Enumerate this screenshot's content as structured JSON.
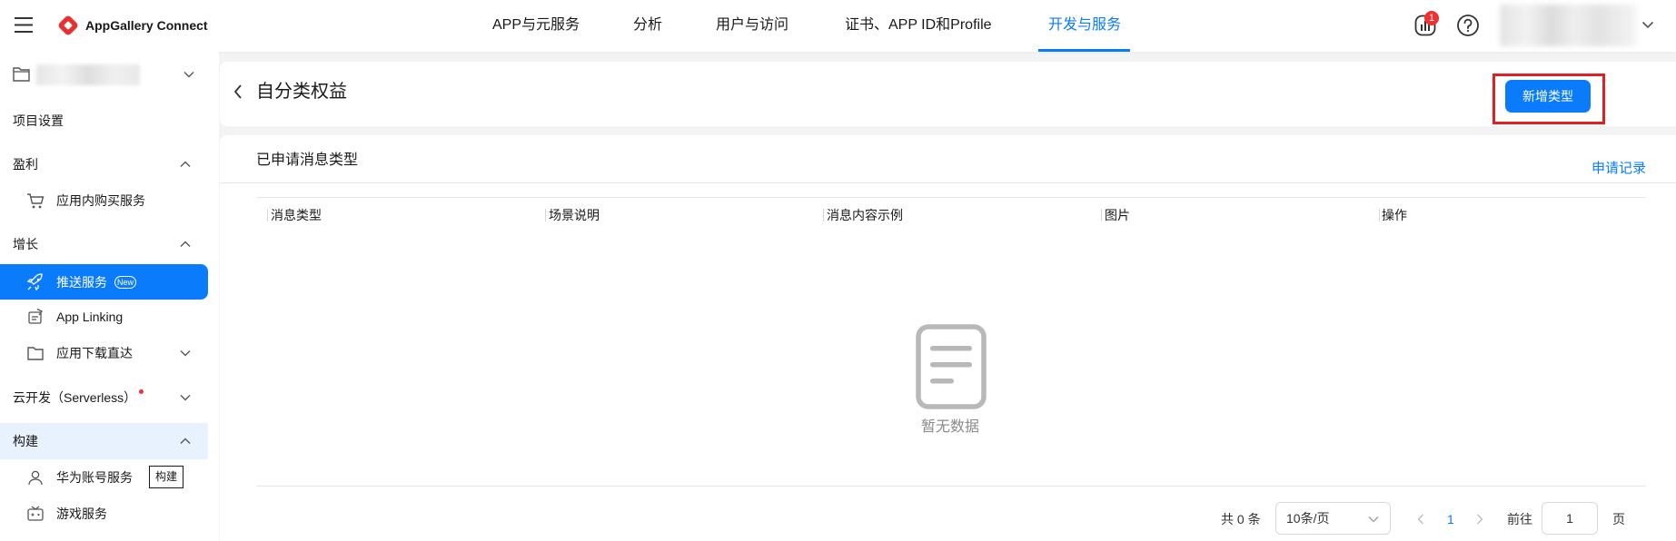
{
  "app": {
    "brand_name": "AppGallery Connect",
    "brand_color": "#e8302f",
    "accent_color": "#0a7cfb"
  },
  "top_nav": {
    "items": [
      {
        "label": "APP与元服务",
        "active": false
      },
      {
        "label": "分析",
        "active": false
      },
      {
        "label": "用户与访问",
        "active": false
      },
      {
        "label": "证书、APP ID和Profile",
        "active": false
      },
      {
        "label": "开发与服务",
        "active": true
      }
    ],
    "notification_count": "1",
    "icons": [
      "menu-icon",
      "appgallery-logo",
      "stats-icon",
      "help-icon",
      "chevron-down-icon"
    ]
  },
  "sidebar": {
    "project_settings": "项目设置",
    "groups": [
      {
        "label": "盈利",
        "expanded": true,
        "items": [
          {
            "label": "应用内购买服务",
            "icon": "cart-icon"
          }
        ]
      },
      {
        "label": "增长",
        "expanded": true,
        "items": [
          {
            "label": "推送服务",
            "icon": "rocket-icon",
            "active": true,
            "badge": "New"
          },
          {
            "label": "App Linking",
            "icon": "app-linking-icon"
          },
          {
            "label": "应用下载直达",
            "icon": "folder-icon",
            "expandable": true
          }
        ]
      },
      {
        "label": "云开发（Serverless）",
        "expanded": false,
        "has_dot": true
      },
      {
        "label": "构建",
        "expanded": true,
        "highlighted": true,
        "items": [
          {
            "label": "华为账号服务",
            "icon": "user-icon",
            "tooltip": "构建"
          },
          {
            "label": "游戏服务",
            "icon": "gamepad-icon"
          }
        ]
      }
    ]
  },
  "page_header": {
    "title": "自分类权益",
    "primary_button": "新增类型",
    "highlight_color": "#e02020"
  },
  "panel": {
    "title": "已申请消息类型",
    "link": "申请记录",
    "columns": [
      "消息类型",
      "场景说明",
      "消息内容示例",
      "图片",
      "操作"
    ],
    "rows": [],
    "empty_text": "暂无数据"
  },
  "pagination": {
    "total": "共 0 条",
    "page_size": "10条/页",
    "current_page": "1",
    "goto_label": "前往",
    "goto_value": "1",
    "page_suffix": "页"
  }
}
